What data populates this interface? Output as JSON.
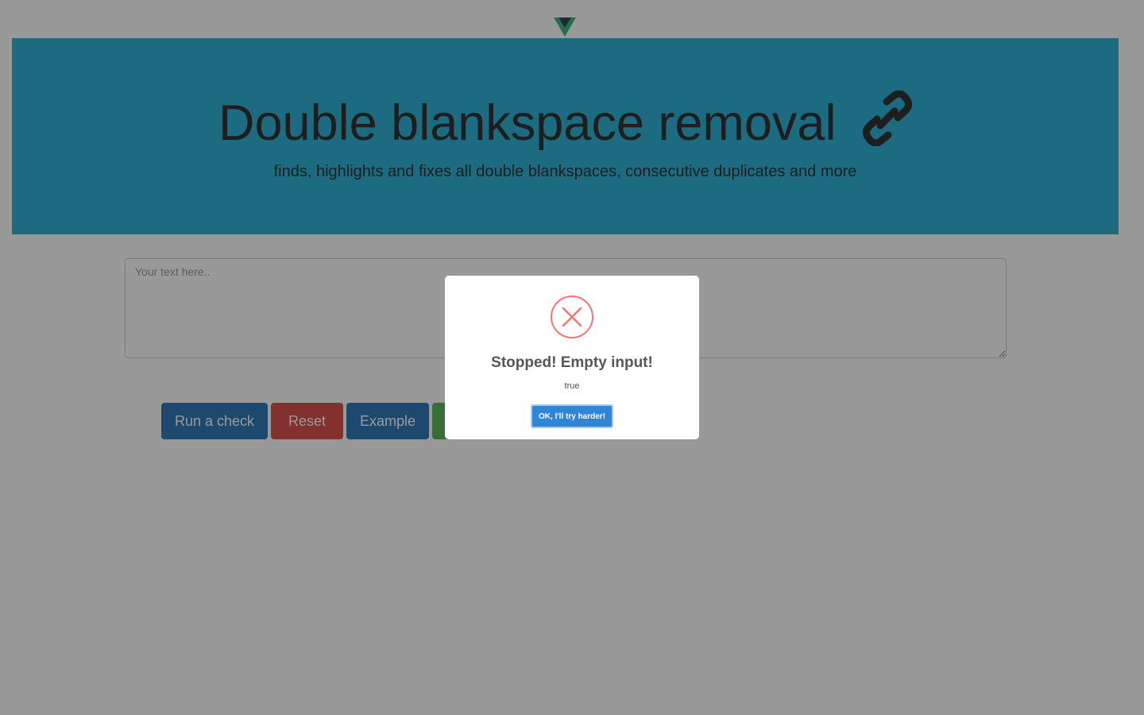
{
  "header": {
    "logo_icon": "vue-logo-icon",
    "title": "Double blankspace removal",
    "title_icon": "link-icon",
    "subtitle": "finds, highlights and fixes all double blankspaces, consecutive duplicates and more"
  },
  "editor": {
    "placeholder": "Your text here.."
  },
  "toolbar": {
    "run_label": "Run a check",
    "reset_label": "Reset",
    "example_label": "Example",
    "fourth_label": ""
  },
  "modal": {
    "icon": "error-x-icon",
    "title": "Stopped! Empty input!",
    "text": "true",
    "confirm_label": "OK, I'll try harder!"
  },
  "colors": {
    "jumbotron": "#2fb3d6",
    "primary": "#337ab7",
    "danger": "#d9534f",
    "success": "#5cb85c",
    "modal_button": "#3085d6",
    "error_icon": "#f27474"
  }
}
